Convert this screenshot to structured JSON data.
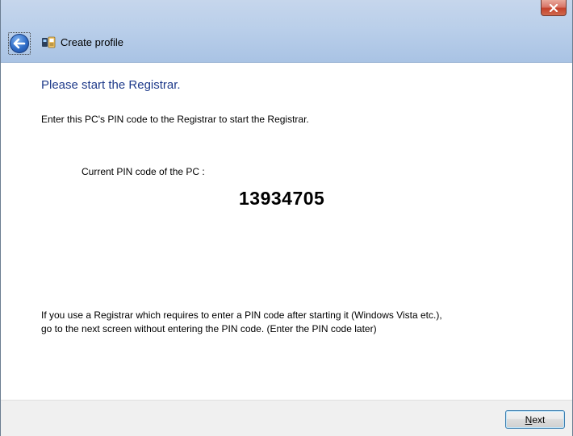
{
  "window": {
    "title": "Create profile",
    "close_icon": "close-icon",
    "back_icon": "back-arrow-icon",
    "app_icon": "profile-icon"
  },
  "content": {
    "heading": "Please start the Registrar.",
    "instruction": "Enter this PC's PIN code to the Registrar to start the Registrar.",
    "pin_label": "Current PIN code of the PC :",
    "pin_value": "13934705",
    "note_line1": "If you use a Registrar which requires to enter a PIN code after starting it (Windows Vista etc.),",
    "note_line2": "go to the next screen without entering the PIN code. (Enter the PIN code later)"
  },
  "footer": {
    "next_label_accel": "N",
    "next_label_rest": "ext"
  },
  "colors": {
    "heading": "#1e3a8a",
    "titlebar": "#bacfea",
    "close_button": "#c4412b",
    "footer": "#f0f0f0"
  }
}
